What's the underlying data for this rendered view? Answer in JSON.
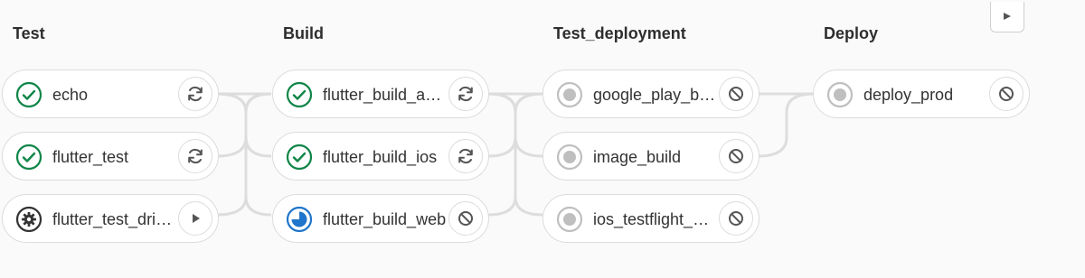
{
  "stages": [
    {
      "title": "Test"
    },
    {
      "title": "Build"
    },
    {
      "title": "Test_deployment"
    },
    {
      "title": "Deploy"
    }
  ],
  "jobs": {
    "echo": {
      "name": "echo",
      "status": "success",
      "action": "retry"
    },
    "flutter_test": {
      "name": "flutter_test",
      "status": "success",
      "action": "retry"
    },
    "flutter_test_driver": {
      "name": "flutter_test_driver",
      "status": "manual",
      "action": "play"
    },
    "flutter_build_android": {
      "name": "flutter_build_an…",
      "status": "success",
      "action": "retry"
    },
    "flutter_build_ios": {
      "name": "flutter_build_ios",
      "status": "success",
      "action": "retry"
    },
    "flutter_build_web": {
      "name": "flutter_build_web",
      "status": "running",
      "action": "cancel"
    },
    "google_play_beta": {
      "name": "google_play_be…",
      "status": "created",
      "action": "cancel"
    },
    "image_build": {
      "name": "image_build",
      "status": "created",
      "action": "cancel"
    },
    "ios_testflight_beta": {
      "name": "ios_testflight_b…",
      "status": "created",
      "action": "cancel"
    },
    "deploy_prod": {
      "name": "deploy_prod",
      "status": "created",
      "action": "cancel"
    }
  },
  "icons": {
    "success": "check-circle-icon",
    "manual": "gear-icon",
    "running": "running-pie-icon",
    "created": "created-dot-icon",
    "retry": "retry-icon",
    "play": "play-icon",
    "cancel": "cancel-icon",
    "corner": "flag-icon"
  },
  "colors": {
    "success": "#108548",
    "running": "#1f75cb",
    "created": "#bfbfbf",
    "manual": "#333333",
    "connector": "#dddddd"
  }
}
